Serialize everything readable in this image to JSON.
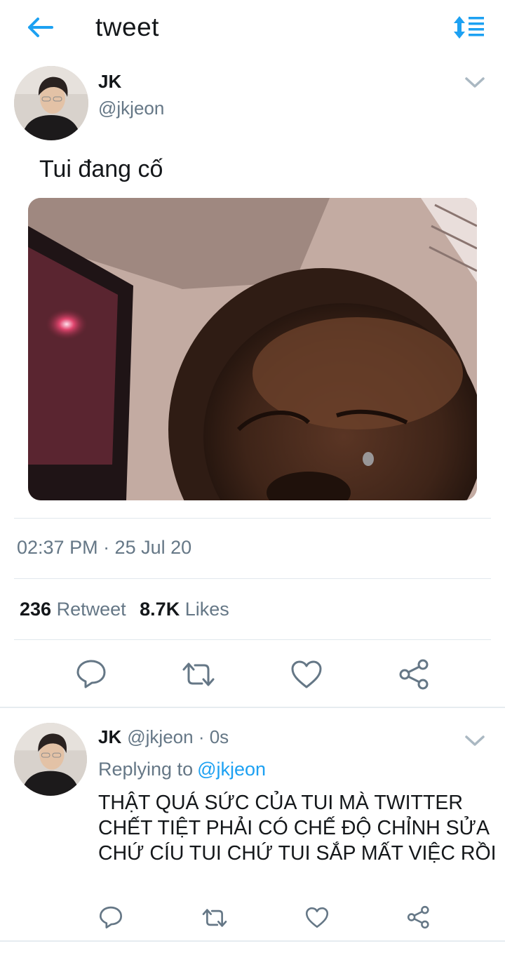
{
  "header": {
    "title": "tweet",
    "back_icon": "arrow-left-icon",
    "sort_icon": "sort-list-icon",
    "accent_color": "#1da1f2"
  },
  "tweet": {
    "author_name": "JK",
    "author_handle": "@jkjeon",
    "text": "Tui đang cố",
    "timestamp": "02:37 PM · 25 Jul 20",
    "retweet_count": "236",
    "retweet_label": "Retweet",
    "like_count": "8.7K",
    "like_label": "Likes",
    "actions": [
      "reply-icon",
      "retweet-icon",
      "like-icon",
      "share-icon"
    ]
  },
  "reply": {
    "author_name": "JK",
    "author_handle": "@jkjeon",
    "time": "· 0s",
    "replying_label": "Replying to",
    "replying_to": "@jkjeon",
    "text": "THẬT QUÁ SỨC CỦA TUI MÀ TWITTER CHẾT TIỆT PHẢI CÓ CHẾ ĐỘ CHỈNH SỬA CHỨ CÍU TUI CHỨ TUI SẮP MẤT VIỆC RỒI"
  },
  "colors": {
    "text_primary": "#14171a",
    "text_secondary": "#657786",
    "icon_gray": "#657786",
    "divider": "#e1e8ed"
  }
}
